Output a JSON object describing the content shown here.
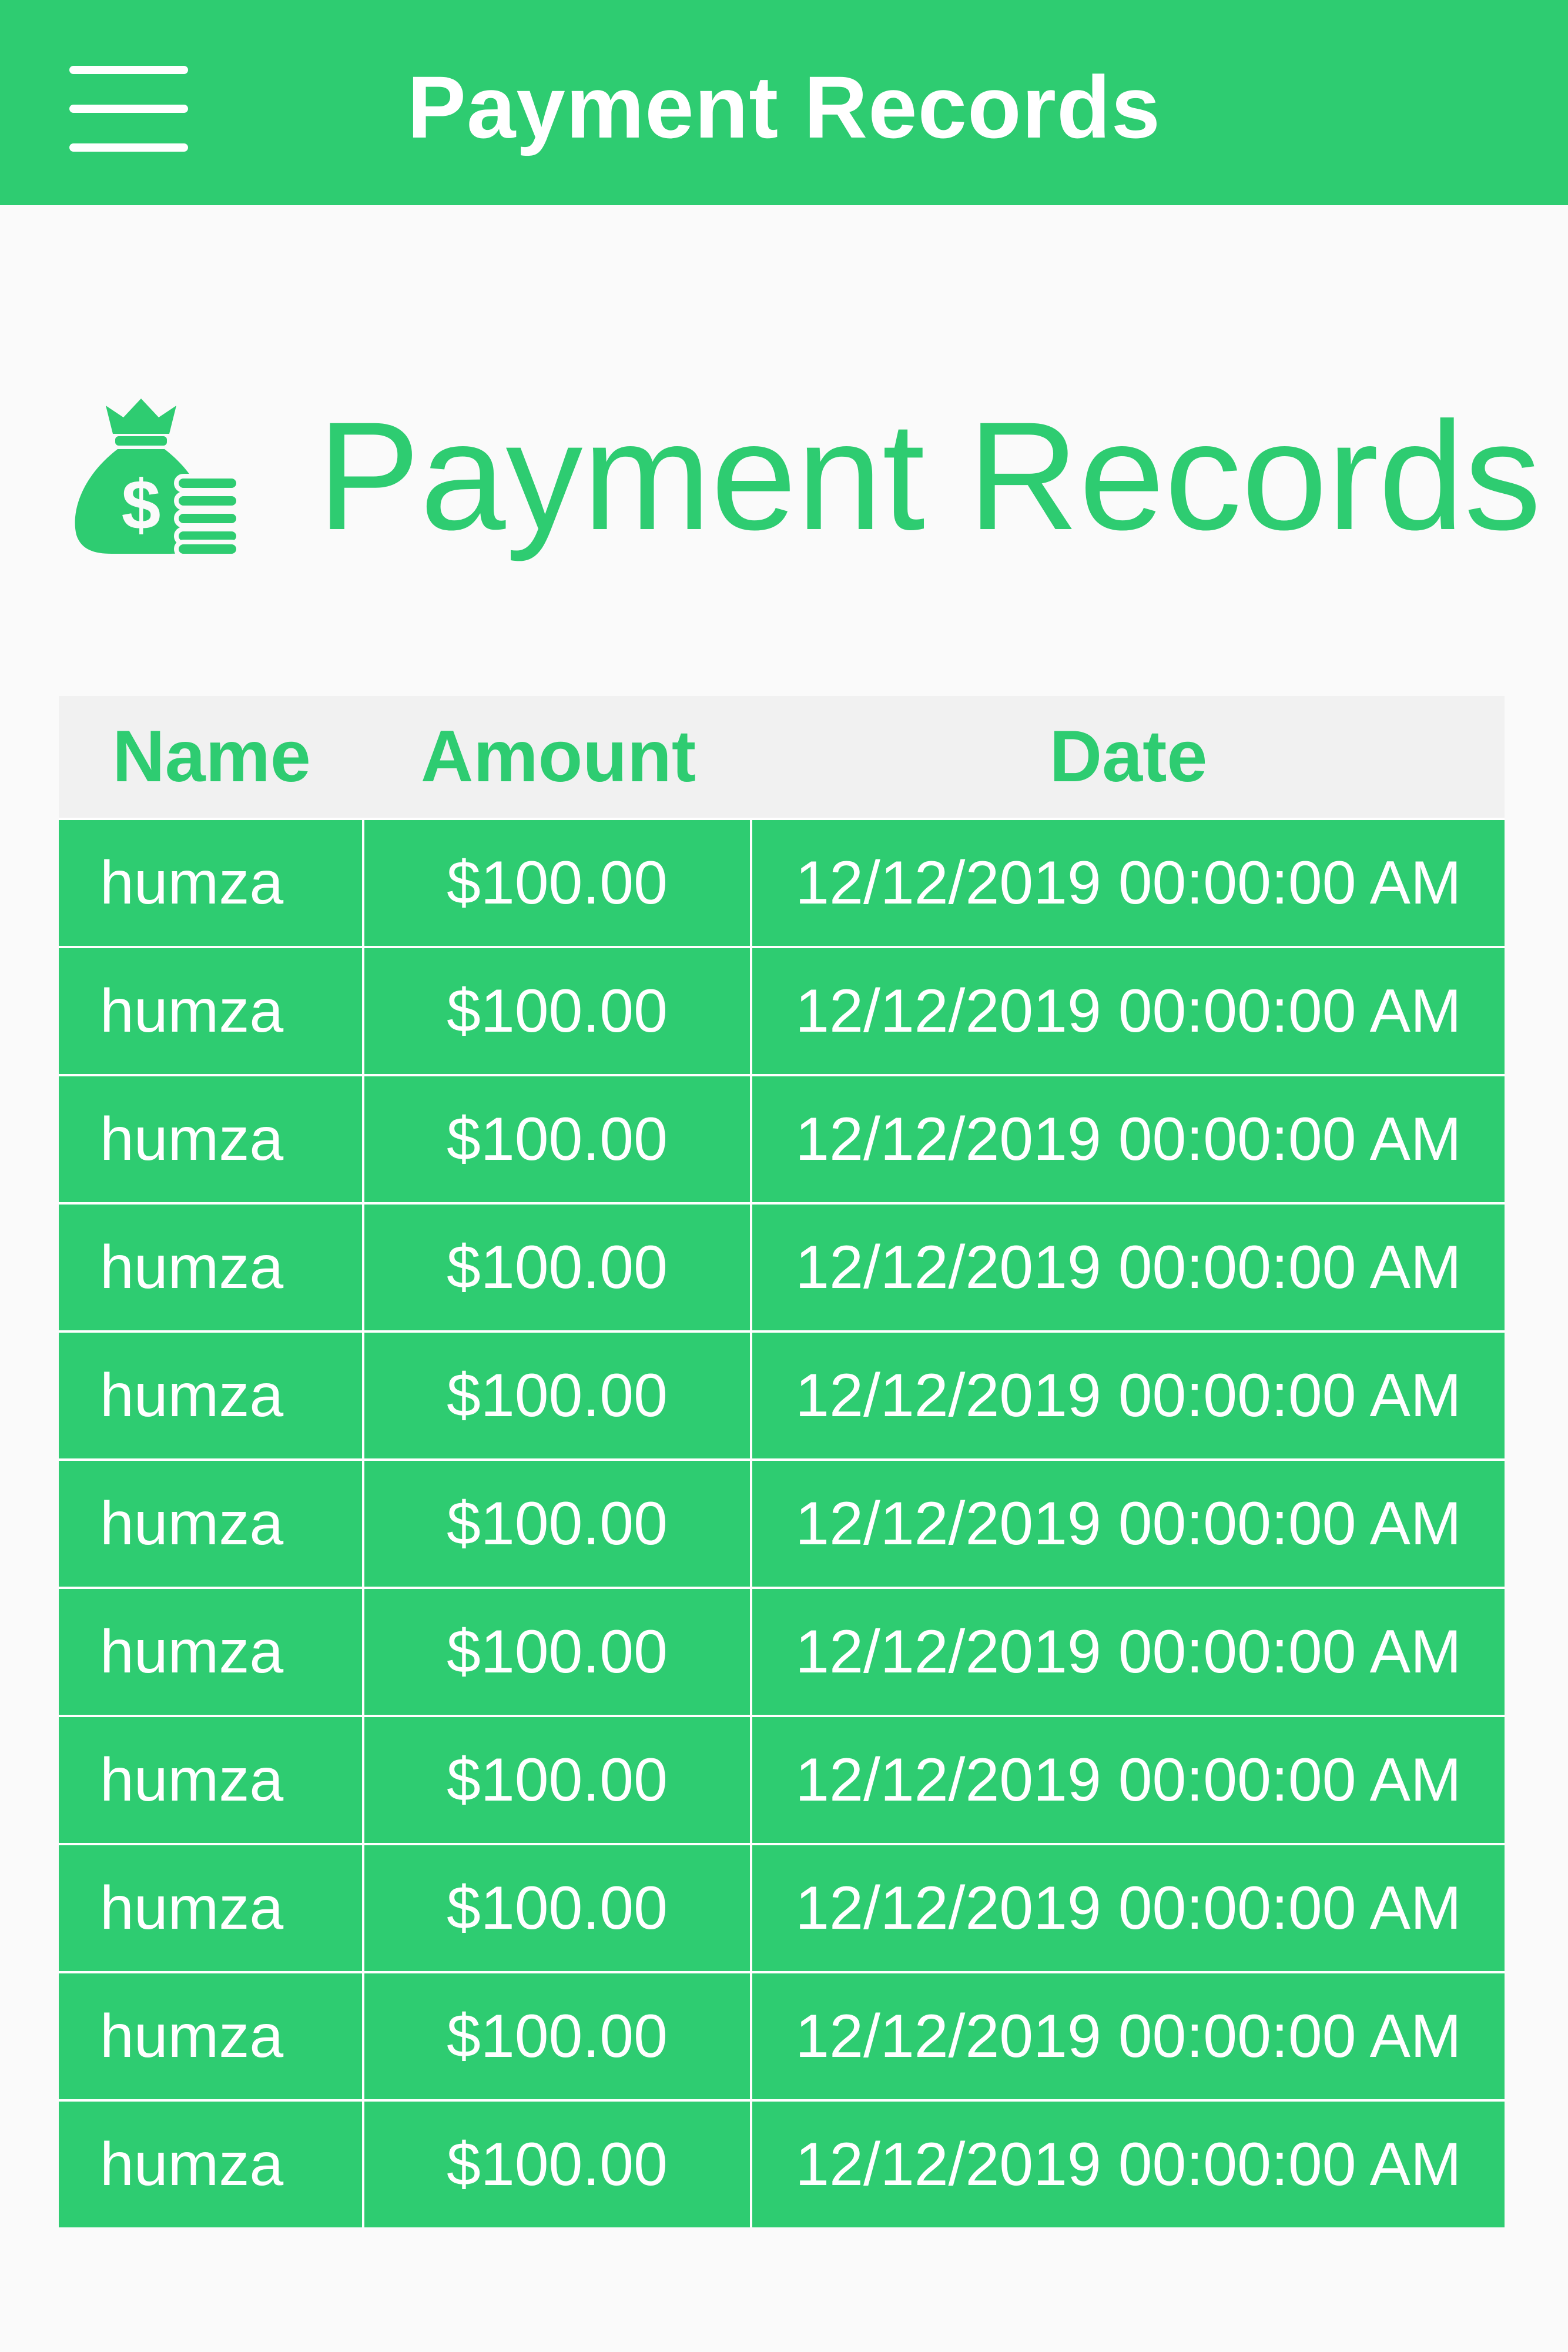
{
  "appbar": {
    "menu_icon": "hamburger-menu-icon",
    "title": "Payment Records"
  },
  "heading": {
    "icon": "money-bag-icon",
    "title": "Payment Records"
  },
  "colors": {
    "accent": "#2ecc71",
    "header_bg": "#f1f1f1",
    "page_bg": "#fafafa",
    "text_on_accent": "#ffffff"
  },
  "table": {
    "columns": [
      "Name",
      "Amount",
      "Date"
    ],
    "rows": [
      [
        "humza",
        "$100.00",
        "12/12/2019 00:00:00 AM"
      ],
      [
        "humza",
        "$100.00",
        "12/12/2019 00:00:00 AM"
      ],
      [
        "humza",
        "$100.00",
        "12/12/2019 00:00:00 AM"
      ],
      [
        "humza",
        "$100.00",
        "12/12/2019 00:00:00 AM"
      ],
      [
        "humza",
        "$100.00",
        "12/12/2019 00:00:00 AM"
      ],
      [
        "humza",
        "$100.00",
        "12/12/2019 00:00:00 AM"
      ],
      [
        "humza",
        "$100.00",
        "12/12/2019 00:00:00 AM"
      ],
      [
        "humza",
        "$100.00",
        "12/12/2019 00:00:00 AM"
      ],
      [
        "humza",
        "$100.00",
        "12/12/2019 00:00:00 AM"
      ],
      [
        "humza",
        "$100.00",
        "12/12/2019 00:00:00 AM"
      ],
      [
        "humza",
        "$100.00",
        "12/12/2019 00:00:00 AM"
      ]
    ]
  }
}
